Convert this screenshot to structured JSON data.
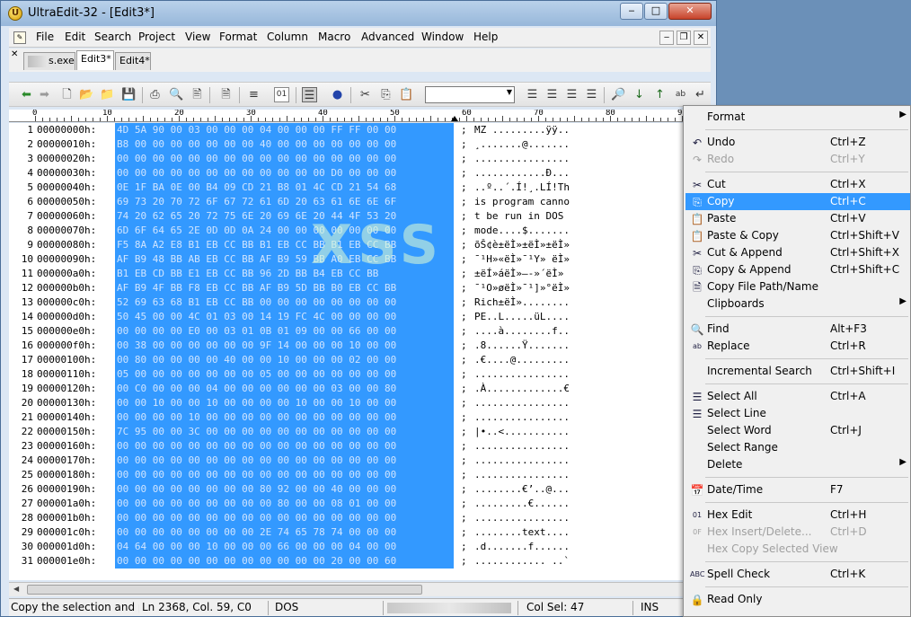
{
  "window": {
    "title": "UltraEdit-32 - [Edit3*]",
    "app_icon": "U",
    "minimize_icon": "minimize-icon",
    "maximize_icon": "maximize-icon",
    "close_icon": "close-icon"
  },
  "menubar": {
    "items": [
      "File",
      "Edit",
      "Search",
      "Project",
      "View",
      "Format",
      "Column",
      "Macro",
      "Advanced",
      "Window",
      "Help"
    ]
  },
  "tabs": {
    "items": [
      {
        "label": "s.exe",
        "active": false
      },
      {
        "label": "Edit3*",
        "active": true
      },
      {
        "label": "Edit4*",
        "active": false
      }
    ]
  },
  "toolbar": {
    "combo_value": ""
  },
  "ruler": {
    "labels": [
      "0",
      "10",
      "20",
      "30",
      "40",
      "50",
      "60",
      "70",
      "80",
      "90"
    ]
  },
  "editor": {
    "watermark": "XSS",
    "rows": [
      {
        "ln": "1",
        "off": "00000000h:",
        "hex": "4D 5A 90 00 03 00 00 00 04 00 00 00 FF FF 00 00",
        "ascii": "MZ .........ÿÿ.."
      },
      {
        "ln": "2",
        "off": "00000010h:",
        "hex": "B8 00 00 00 00 00 00 00 40 00 00 00 00 00 00 00",
        "ascii": "¸.......@......."
      },
      {
        "ln": "3",
        "off": "00000020h:",
        "hex": "00 00 00 00 00 00 00 00 00 00 00 00 00 00 00 00",
        "ascii": "................"
      },
      {
        "ln": "4",
        "off": "00000030h:",
        "hex": "00 00 00 00 00 00 00 00 00 00 00 00 D0 00 00 00",
        "ascii": "............Ð..."
      },
      {
        "ln": "5",
        "off": "00000040h:",
        "hex": "0E 1F BA 0E 00 B4 09 CD 21 B8 01 4C CD 21 54 68",
        "ascii": "..º..´.Í!¸.LÍ!Th"
      },
      {
        "ln": "6",
        "off": "00000050h:",
        "hex": "69 73 20 70 72 6F 67 72 61 6D 20 63 61 6E 6E 6F",
        "ascii": "is program canno"
      },
      {
        "ln": "7",
        "off": "00000060h:",
        "hex": "74 20 62 65 20 72 75 6E 20 69 6E 20 44 4F 53 20",
        "ascii": "t be run in DOS "
      },
      {
        "ln": "8",
        "off": "00000070h:",
        "hex": "6D 6F 64 65 2E 0D 0D 0A 24 00 00 00 00 00 00 00",
        "ascii": "mode....$......."
      },
      {
        "ln": "9",
        "off": "00000080h:",
        "hex": "F5 8A A2 E8 B1 EB CC BB B1 EB CC BB B1 EB CC BB",
        "ascii": "õŠ¢è±ëÌ»±ëÌ»±ëÌ»"
      },
      {
        "ln": "10",
        "off": "00000090h:",
        "hex": "AF B9 48 BB AB EB CC BB AF B9 59 BB A0 EB CC BB",
        "ascii": "¯¹H»«ëÌ»¯¹Y» ëÌ»"
      },
      {
        "ln": "11",
        "off": "000000a0h:",
        "hex": "B1 EB CD BB E1 EB CC BB 96 2D BB B4 EB CC BB",
        "ascii": "±ëÍ»áëÌ»–-»´ëÌ»"
      },
      {
        "ln": "12",
        "off": "000000b0h:",
        "hex": "AF B9 4F BB F8 EB CC BB AF B9 5D BB B0 EB CC BB",
        "ascii": "¯¹O»øëÌ»¯¹]»°ëÌ»"
      },
      {
        "ln": "13",
        "off": "000000c0h:",
        "hex": "52 69 63 68 B1 EB CC BB 00 00 00 00 00 00 00 00",
        "ascii": "Rich±ëÌ»........"
      },
      {
        "ln": "14",
        "off": "000000d0h:",
        "hex": "50 45 00 00 4C 01 03 00 14 19 FC 4C 00 00 00 00",
        "ascii": "PE..L.....üL...."
      },
      {
        "ln": "15",
        "off": "000000e0h:",
        "hex": "00 00 00 00 E0 00 03 01 0B 01 09 00 00 66 00 00",
        "ascii": "....à........f.."
      },
      {
        "ln": "16",
        "off": "000000f0h:",
        "hex": "00 38 00 00 00 00 00 00 9F 14 00 00 00 10 00 00",
        "ascii": ".8......Ÿ......."
      },
      {
        "ln": "17",
        "off": "00000100h:",
        "hex": "00 80 00 00 00 00 40 00 00 10 00 00 00 02 00 00",
        "ascii": ".€....@........."
      },
      {
        "ln": "18",
        "off": "00000110h:",
        "hex": "05 00 00 00 00 00 00 00 05 00 00 00 00 00 00 00",
        "ascii": "................"
      },
      {
        "ln": "19",
        "off": "00000120h:",
        "hex": "00 C0 00 00 00 04 00 00 00 00 00 00 03 00 00 80",
        "ascii": ".À.............€"
      },
      {
        "ln": "20",
        "off": "00000130h:",
        "hex": "00 00 10 00 00 10 00 00 00 00 10 00 00 10 00 00",
        "ascii": "................"
      },
      {
        "ln": "21",
        "off": "00000140h:",
        "hex": "00 00 00 00 10 00 00 00 00 00 00 00 00 00 00 00",
        "ascii": "................"
      },
      {
        "ln": "22",
        "off": "00000150h:",
        "hex": "7C 95 00 00 3C 00 00 00 00 00 00 00 00 00 00 00",
        "ascii": "|•..<..........."
      },
      {
        "ln": "23",
        "off": "00000160h:",
        "hex": "00 00 00 00 00 00 00 00 00 00 00 00 00 00 00 00",
        "ascii": "................"
      },
      {
        "ln": "24",
        "off": "00000170h:",
        "hex": "00 00 00 00 00 00 00 00 00 00 00 00 00 00 00 00",
        "ascii": "................"
      },
      {
        "ln": "25",
        "off": "00000180h:",
        "hex": "00 00 00 00 00 00 00 00 00 00 00 00 00 00 00 00",
        "ascii": "................"
      },
      {
        "ln": "26",
        "off": "00000190h:",
        "hex": "00 00 00 00 00 00 00 00 80 92 00 00 40 00 00 00",
        "ascii": "........€’..@..."
      },
      {
        "ln": "27",
        "off": "000001a0h:",
        "hex": "00 00 00 00 00 00 00 00 00 80 00 00 08 01 00 00",
        "ascii": ".........€......"
      },
      {
        "ln": "28",
        "off": "000001b0h:",
        "hex": "00 00 00 00 00 00 00 00 00 00 00 00 00 00 00 00",
        "ascii": "................"
      },
      {
        "ln": "29",
        "off": "000001c0h:",
        "hex": "00 00 00 00 00 00 00 00 2E 74 65 78 74 00 00 00",
        "ascii": "........text...."
      },
      {
        "ln": "30",
        "off": "000001d0h:",
        "hex": "04 64 00 00 00 10 00 00 00 66 00 00 00 04 00 00",
        "ascii": ".d.......f......"
      },
      {
        "ln": "31",
        "off": "000001e0h:",
        "hex": "00 00 00 00 00 00 00 00 00 00 00 00 20 00 00 60",
        "ascii": "............ ..`"
      }
    ]
  },
  "statusbar": {
    "hint": "Copy the selection and put it on the Clipboard",
    "position": "Ln 2368, Col. 59, C0",
    "format": "DOS",
    "col_sel": "Col Sel: 47",
    "mode": "INS"
  },
  "context_menu": {
    "items": [
      {
        "type": "item",
        "label": "Format",
        "shortcut": "",
        "icon": "",
        "submenu": true
      },
      {
        "type": "sep"
      },
      {
        "type": "item",
        "label": "Undo",
        "shortcut": "Ctrl+Z",
        "icon": "undo-icon"
      },
      {
        "type": "item",
        "label": "Redo",
        "shortcut": "Ctrl+Y",
        "icon": "redo-icon",
        "disabled": true
      },
      {
        "type": "sep"
      },
      {
        "type": "item",
        "label": "Cut",
        "shortcut": "Ctrl+X",
        "icon": "cut-icon"
      },
      {
        "type": "item",
        "label": "Copy",
        "shortcut": "Ctrl+C",
        "icon": "copy-icon",
        "highlighted": true
      },
      {
        "type": "item",
        "label": "Paste",
        "shortcut": "Ctrl+V",
        "icon": "paste-icon"
      },
      {
        "type": "item",
        "label": "Paste & Copy",
        "shortcut": "Ctrl+Shift+V",
        "icon": "paste-copy-icon"
      },
      {
        "type": "item",
        "label": "Cut & Append",
        "shortcut": "Ctrl+Shift+X",
        "icon": "cut-append-icon"
      },
      {
        "type": "item",
        "label": "Copy & Append",
        "shortcut": "Ctrl+Shift+C",
        "icon": "copy-append-icon"
      },
      {
        "type": "item",
        "label": "Copy File Path/Name",
        "shortcut": "",
        "icon": "copy-path-icon"
      },
      {
        "type": "item",
        "label": "Clipboards",
        "shortcut": "",
        "icon": "",
        "submenu": true
      },
      {
        "type": "sep"
      },
      {
        "type": "item",
        "label": "Find",
        "shortcut": "Alt+F3",
        "icon": "find-icon"
      },
      {
        "type": "item",
        "label": "Replace",
        "shortcut": "Ctrl+R",
        "icon": "replace-icon"
      },
      {
        "type": "sep"
      },
      {
        "type": "item",
        "label": "Incremental Search",
        "shortcut": "Ctrl+Shift+I",
        "icon": ""
      },
      {
        "type": "sep"
      },
      {
        "type": "item",
        "label": "Select All",
        "shortcut": "Ctrl+A",
        "icon": "select-all-icon"
      },
      {
        "type": "item",
        "label": "Select Line",
        "shortcut": "",
        "icon": "select-line-icon"
      },
      {
        "type": "item",
        "label": "Select Word",
        "shortcut": "Ctrl+J",
        "icon": ""
      },
      {
        "type": "item",
        "label": "Select Range",
        "shortcut": "",
        "icon": ""
      },
      {
        "type": "item",
        "label": "Delete",
        "shortcut": "",
        "icon": "",
        "submenu": true
      },
      {
        "type": "sep"
      },
      {
        "type": "item",
        "label": "Date/Time",
        "shortcut": "F7",
        "icon": "date-time-icon"
      },
      {
        "type": "sep"
      },
      {
        "type": "item",
        "label": "Hex Edit",
        "shortcut": "Ctrl+H",
        "icon": "hex-edit-icon"
      },
      {
        "type": "item",
        "label": "Hex Insert/Delete...",
        "shortcut": "Ctrl+D",
        "icon": "hex-insert-icon",
        "disabled": true
      },
      {
        "type": "item",
        "label": "Hex Copy Selected View",
        "shortcut": "",
        "icon": "",
        "disabled": true
      },
      {
        "type": "sep"
      },
      {
        "type": "item",
        "label": "Spell Check",
        "shortcut": "Ctrl+K",
        "icon": "spell-check-icon"
      },
      {
        "type": "sep"
      },
      {
        "type": "item",
        "label": "Read Only",
        "shortcut": "",
        "icon": "read-only-icon"
      }
    ]
  }
}
